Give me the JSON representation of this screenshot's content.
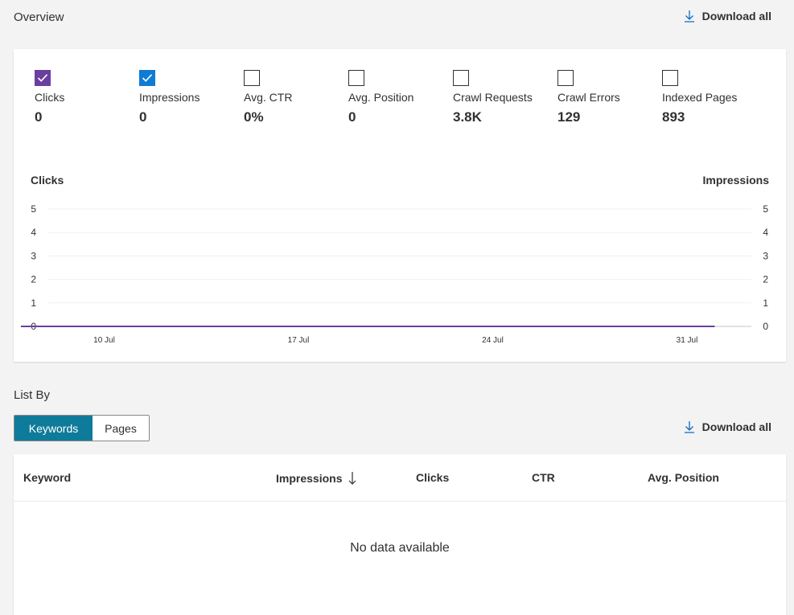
{
  "overview": {
    "title": "Overview",
    "download_label": "Download all",
    "metrics": [
      {
        "label": "Clicks",
        "value": "0",
        "checked": true,
        "color": "#6b3fa0"
      },
      {
        "label": "Impressions",
        "value": "0",
        "checked": true,
        "color": "#0f7bd4"
      },
      {
        "label": "Avg. CTR",
        "value": "0%",
        "checked": false
      },
      {
        "label": "Avg. Position",
        "value": "0",
        "checked": false
      },
      {
        "label": "Crawl Requests",
        "value": "3.8K",
        "checked": false
      },
      {
        "label": "Crawl Errors",
        "value": "129",
        "checked": false
      },
      {
        "label": "Indexed Pages",
        "value": "893",
        "checked": false
      }
    ]
  },
  "chart_data": {
    "type": "line",
    "ylabel_left": "Clicks",
    "ylabel_right": "Impressions",
    "yticks": [
      "0",
      "1",
      "2",
      "3",
      "4",
      "5"
    ],
    "ylim": [
      0,
      5
    ],
    "xticks": [
      "10 Jul",
      "17 Jul",
      "24 Jul",
      "31 Jul"
    ],
    "grid": true,
    "series": [
      {
        "name": "Clicks",
        "color": "#6b3fa0",
        "x": [
          "7 Jul",
          "1 Aug"
        ],
        "values": [
          0,
          0
        ]
      },
      {
        "name": "Impressions",
        "color": "#0f7bd4",
        "x": [
          "7 Jul",
          "1 Aug"
        ],
        "values": [
          0,
          0
        ]
      }
    ]
  },
  "listby": {
    "title": "List By",
    "tabs": [
      "Keywords",
      "Pages"
    ],
    "active_tab": "Keywords",
    "download_label": "Download all"
  },
  "table": {
    "columns": [
      "Keyword",
      "Impressions",
      "Clicks",
      "CTR",
      "Avg. Position"
    ],
    "sorted_column": "Impressions",
    "empty_message": "No data available"
  }
}
